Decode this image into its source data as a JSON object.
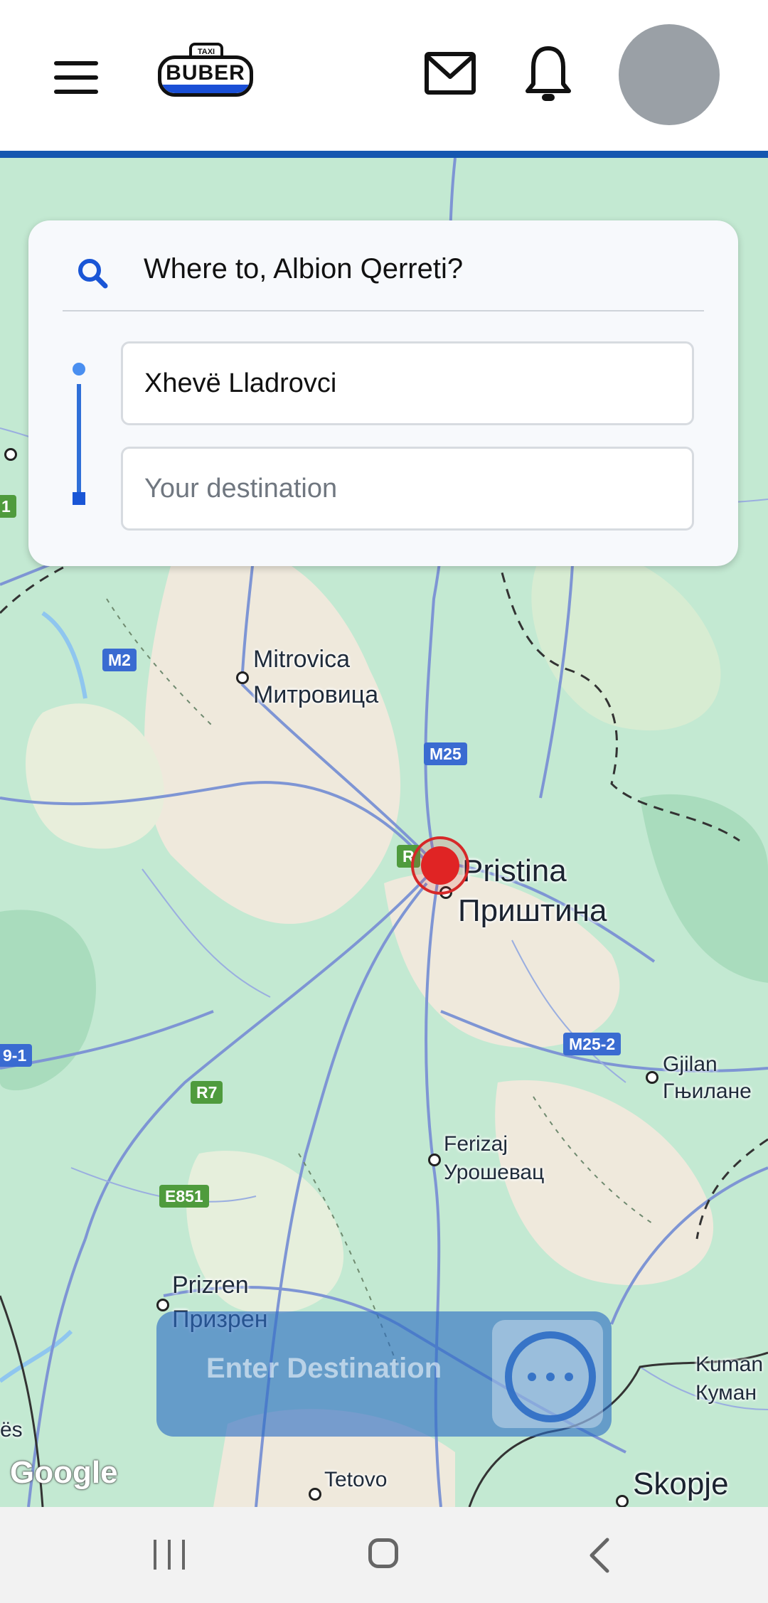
{
  "header": {
    "logo_small_text": "TAXI",
    "logo_text": "BUBER",
    "accent_color": "#1557b0"
  },
  "search": {
    "title": "Where to, Albion Qerreti?",
    "origin_value": "Xhevë Lladrovci",
    "destination_placeholder": "Your destination"
  },
  "map": {
    "labels": {
      "mitrovica": "Mitrovica",
      "mitrovica_cyr": "Митровица",
      "pristina": "Pristina",
      "pristina_cyr": "Приштина",
      "gjilan": "Gjilan",
      "gjilan_cyr": "Гњилане",
      "ferizaj": "Ferizaj",
      "ferizaj_cyr": "Урошевац",
      "prizren": "Prizren",
      "prizren_cyr": "Призрен",
      "tetovo": "Tetovo",
      "skopje": "Skopje",
      "kumanovo": "Kuman",
      "kumanovo_cyr": "Куман",
      "edge_es": "ës"
    },
    "road_shields": {
      "m2": "M2",
      "m25": "M25",
      "m25_2": "M25-2",
      "r7": "R7",
      "e851": "E851",
      "left_9_1": "9-1",
      "left_1": "1",
      "r_partial": "R"
    },
    "attribution": "Google"
  },
  "bottom_action": {
    "label": "Enter Destination"
  }
}
